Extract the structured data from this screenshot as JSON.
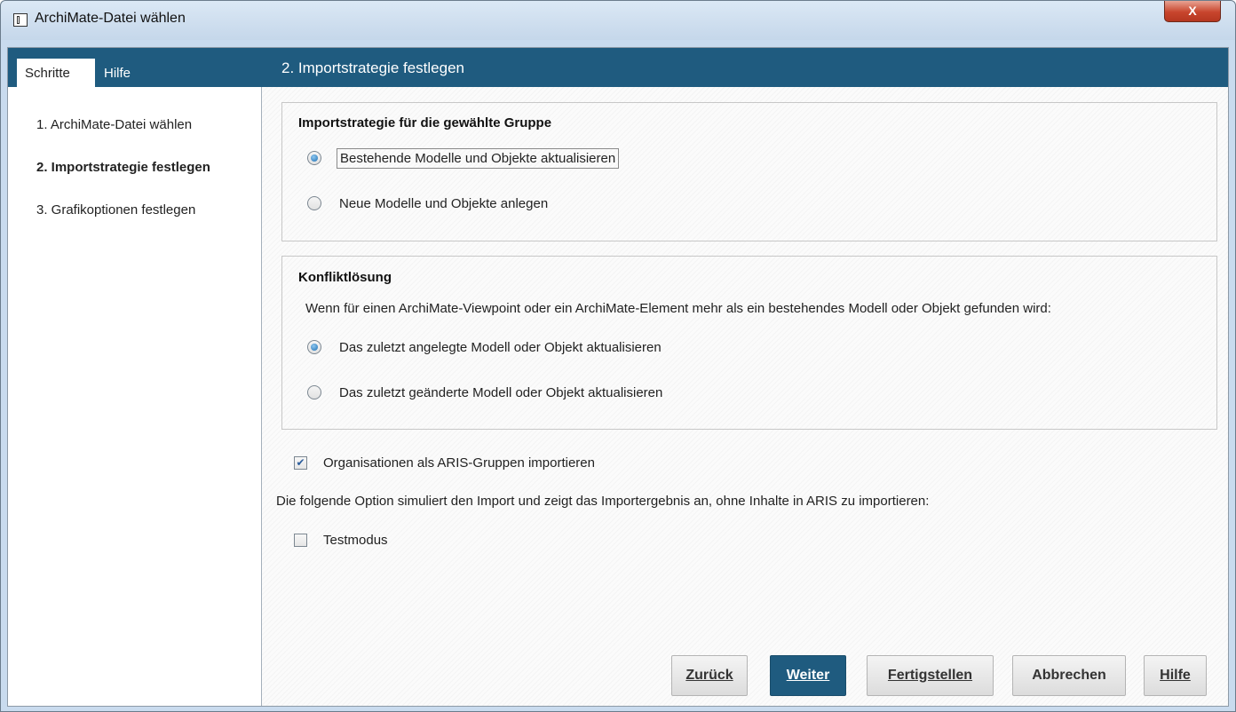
{
  "window": {
    "title": "ArchiMate-Datei wählen",
    "close_label": "X"
  },
  "sidebar": {
    "tabs": [
      "Schritte",
      "Hilfe"
    ],
    "steps": [
      {
        "label": "1. ArchiMate-Datei wählen",
        "active": false
      },
      {
        "label": "2. Importstrategie festlegen",
        "active": true
      },
      {
        "label": "3. Grafikoptionen festlegen",
        "active": false
      }
    ]
  },
  "main": {
    "header": "2. Importstrategie festlegen",
    "strategy_group": {
      "title": "Importstrategie für die gewählte Gruppe",
      "options": [
        {
          "label": "Bestehende Modelle und Objekte aktualisieren",
          "selected": true
        },
        {
          "label": "Neue Modelle und Objekte anlegen",
          "selected": false
        }
      ]
    },
    "conflict_group": {
      "title": "Konfliktlösung",
      "description": "Wenn für einen ArchiMate-Viewpoint oder ein ArchiMate-Element mehr als ein bestehendes Modell oder Objekt gefunden wird:",
      "options": [
        {
          "label": "Das zuletzt angelegte Modell oder Objekt aktualisieren",
          "selected": true
        },
        {
          "label": "Das zuletzt geänderte Modell oder Objekt aktualisieren",
          "selected": false
        }
      ]
    },
    "org_checkbox": {
      "label": "Organisationen als ARIS-Gruppen importieren",
      "checked": true
    },
    "simulation_note": "Die folgende Option simuliert den Import und zeigt das Importergebnis an, ohne Inhalte in ARIS zu importieren:",
    "test_checkbox": {
      "label": "Testmodus",
      "checked": false
    }
  },
  "buttons": {
    "back": "Zurück",
    "next": "Weiter",
    "finish": "Fertigstellen",
    "cancel": "Abbrechen",
    "help": "Hilfe"
  },
  "colors": {
    "header_bg": "#1f5b7f",
    "primary_button": "#1f5b7f",
    "close_button": "#c8452d"
  }
}
